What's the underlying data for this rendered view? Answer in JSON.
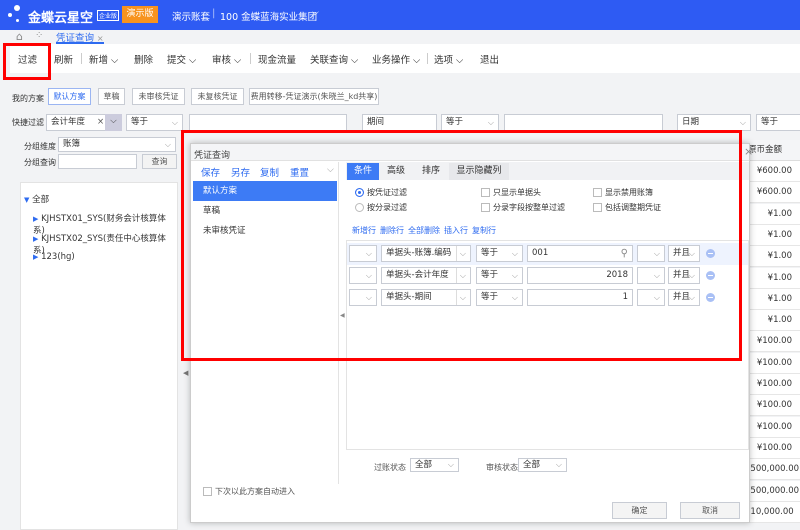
{
  "header": {
    "logo": "金蝶云星空",
    "edition_badge": "企业版",
    "demo_button": "演示版",
    "account": "演示账套",
    "org": "100 金蝶蓝海实业集团"
  },
  "tabs": [
    {
      "label": "凭证查询"
    }
  ],
  "toolbar": [
    "过滤",
    "刷新",
    "新增",
    "删除",
    "提交",
    "审核",
    "现金流量",
    "关联查询",
    "业务操作",
    "选项",
    "退出"
  ],
  "schemes": {
    "label": "我的方案",
    "items": [
      "默认方案",
      "草稿",
      "未审核凭证",
      "未复核凭证",
      "费用转移-凭证演示(朱晓兰_kd共享)"
    ]
  },
  "quick_filter": {
    "label": "快捷过滤",
    "field1": "会计年度",
    "op1": "等于",
    "value1": "",
    "field2": "期间",
    "op2": "等于",
    "value2": "",
    "field3": "日期",
    "op3": "等于"
  },
  "group": {
    "dim_label": "分组维度",
    "dim_value": "账簿",
    "query_label": "分组查询",
    "query_value": "",
    "query_button": "查询"
  },
  "tree": {
    "root": "全部",
    "items": [
      "KJHSTX01_SYS(财务会计核算体系)",
      "KJHSTX02_SYS(责任中心核算体系)",
      "123(hg)"
    ]
  },
  "table": {
    "column": "原币金额",
    "values": [
      "¥600.00",
      "¥600.00",
      "¥1.00",
      "¥1.00",
      "¥1.00",
      "¥1.00",
      "¥1.00",
      "¥1.00",
      "¥100.00",
      "¥100.00",
      "¥100.00",
      "¥100.00",
      "¥100.00",
      "¥100.00",
      "¥500,000.00",
      "¥500,000.00",
      "¥10,000.00"
    ]
  },
  "dialog": {
    "title": "凭证查询",
    "scheme_actions": [
      "保存",
      "另存",
      "复制",
      "重置"
    ],
    "schemes": [
      "默认方案",
      "草稿",
      "未审核凭证"
    ],
    "auto_enter": "下次以此方案自动进入",
    "tabs": [
      "条件",
      "高级",
      "排序",
      "显示隐藏列"
    ],
    "radios": [
      "按凭证过滤",
      "按分录过滤"
    ],
    "checks": [
      "只显示单据头",
      "分录字段按整单过滤",
      "显示禁用账簿",
      "包括调整期凭证"
    ],
    "row_actions": [
      "新增行",
      "删除行",
      "全部删除",
      "插入行",
      "复制行"
    ],
    "conditions": [
      {
        "field": "单据头-账簿.编码",
        "op": "等于",
        "value": "001",
        "logic": "并且"
      },
      {
        "field": "单据头-会计年度",
        "op": "等于",
        "value": "2018",
        "logic": "并且"
      },
      {
        "field": "单据头-期间",
        "op": "等于",
        "value": "1",
        "logic": "并且"
      }
    ],
    "post_label": "过账状态",
    "post_value": "全部",
    "audit_label": "审核状态",
    "audit_value": "全部",
    "ok": "确定",
    "cancel": "取消"
  },
  "watermark": "演示版",
  "colors": {
    "brand": "#2e5bf3",
    "demo": "#f7931e",
    "highlight": "#ff0000",
    "selected": "#3d7bf5"
  }
}
